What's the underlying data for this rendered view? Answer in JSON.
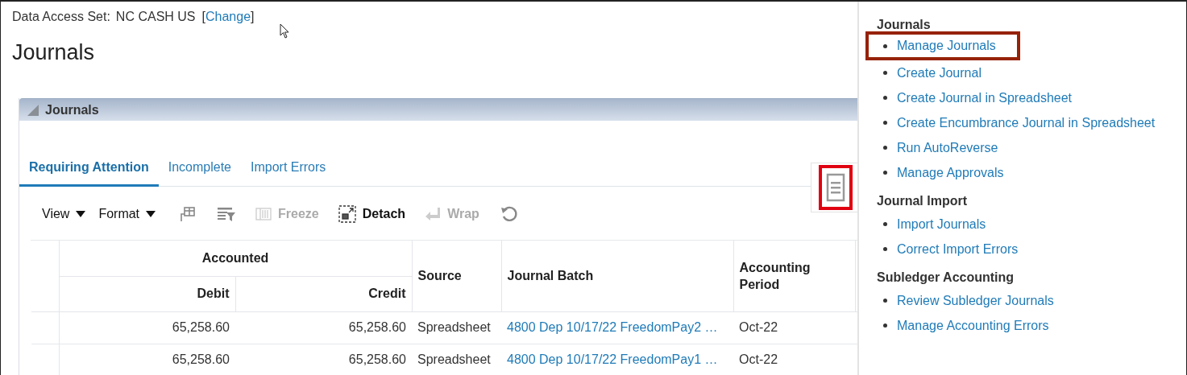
{
  "data_access": {
    "label": "Data Access Set:",
    "value": "NC CASH US",
    "bracket_open": "[",
    "link": "Change",
    "bracket_close": "]"
  },
  "page_title": "Journals",
  "section": {
    "title": "Journals",
    "expanded": true,
    "tabs": [
      {
        "label": "Requiring Attention",
        "selected": true
      },
      {
        "label": "Incomplete",
        "selected": false
      },
      {
        "label": "Import Errors",
        "selected": false
      }
    ],
    "toolbar": [
      {
        "kind": "menu",
        "label": "View"
      },
      {
        "kind": "menu",
        "label": "Format"
      },
      {
        "kind": "columns"
      },
      {
        "kind": "filter"
      },
      {
        "kind": "freeze",
        "label": "Freeze",
        "disabled": true
      },
      {
        "kind": "detach",
        "label": "Detach",
        "disabled": false
      },
      {
        "kind": "wrap",
        "label": "Wrap",
        "disabled": true
      },
      {
        "kind": "refresh"
      }
    ],
    "table": {
      "group_header": "Accounted",
      "columns": [
        "Debit",
        "Credit",
        "Source",
        "Journal Batch",
        "Accounting Period"
      ],
      "rows": [
        {
          "debit": "65,258.60",
          "credit": "65,258.60",
          "source": "Spreadsheet",
          "batch": "4800 Dep 10/17/22 FreedomPay2 …",
          "period": "Oct-22"
        },
        {
          "debit": "65,258.60",
          "credit": "65,258.60",
          "source": "Spreadsheet",
          "batch": "4800 Dep 10/17/22 FreedomPay1 …",
          "period": "Oct-22"
        }
      ]
    }
  },
  "panel_toggle": {
    "highlighted": true
  },
  "tasks": [
    {
      "heading": "Journals",
      "items": [
        {
          "label": "Manage Journals",
          "highlighted": true
        },
        {
          "label": "Create Journal",
          "highlighted": false
        },
        {
          "label": "Create Journal in Spreadsheet",
          "highlighted": false
        },
        {
          "label": "Create Encumbrance Journal in Spreadsheet",
          "highlighted": false
        },
        {
          "label": "Run AutoReverse",
          "highlighted": false
        },
        {
          "label": "Manage Approvals",
          "highlighted": false
        }
      ]
    },
    {
      "heading": "Journal Import",
      "items": [
        {
          "label": "Import Journals",
          "highlighted": false
        },
        {
          "label": "Correct Import Errors",
          "highlighted": false
        }
      ]
    },
    {
      "heading": "Subledger Accounting",
      "items": [
        {
          "label": "Review Subledger Journals",
          "highlighted": false
        },
        {
          "label": "Manage Accounting Errors",
          "highlighted": false
        }
      ]
    }
  ]
}
